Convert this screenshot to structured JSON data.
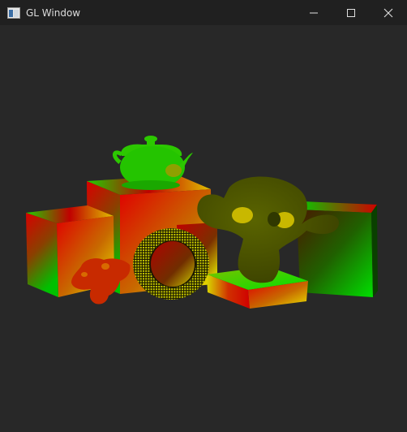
{
  "window": {
    "title": "GL Window",
    "icon": "app-window-icon",
    "controls": {
      "minimize_icon": "minimize-icon",
      "maximize_icon": "maximize-icon",
      "close_icon": "close-icon"
    }
  },
  "scene": {
    "background": "#282828",
    "objects": [
      {
        "name": "cube-left",
        "type": "cube"
      },
      {
        "name": "cube-tall-center",
        "type": "cube"
      },
      {
        "name": "cube-right",
        "type": "cube"
      },
      {
        "name": "cube-small-front",
        "type": "cube"
      },
      {
        "name": "teapot",
        "type": "mesh",
        "color": "#2bd000"
      },
      {
        "name": "torus-wireframe",
        "type": "mesh",
        "color": "#c8c800"
      },
      {
        "name": "monkey-head-large",
        "type": "mesh",
        "color": "#4c5a00"
      },
      {
        "name": "monkey-head-small",
        "type": "mesh",
        "color": "#c82a00"
      }
    ]
  }
}
